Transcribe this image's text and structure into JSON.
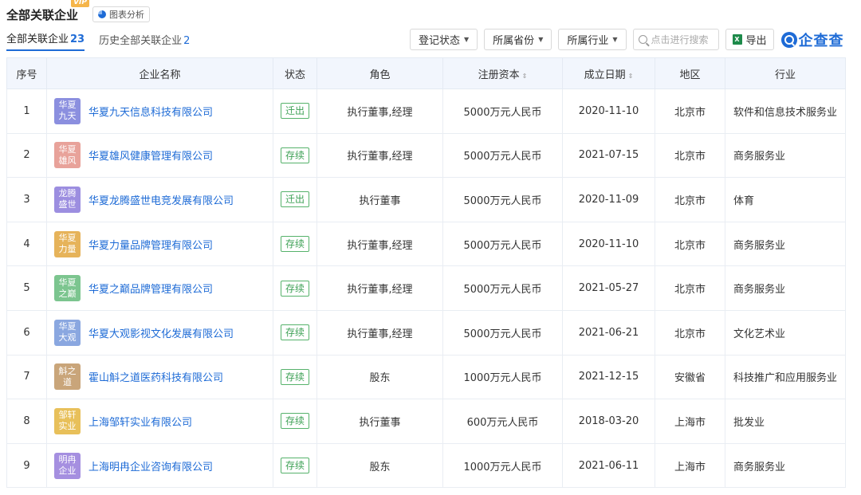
{
  "header": {
    "title": "全部关联企业",
    "vip": "VIP",
    "chart_button": "图表分析"
  },
  "tabs": [
    {
      "label": "全部关联企业",
      "count": "23"
    },
    {
      "label": "历史全部关联企业",
      "count": "2"
    }
  ],
  "toolbar": {
    "filters": [
      "登记状态",
      "所属省份",
      "所属行业"
    ],
    "search_placeholder": "点击进行搜索",
    "export_label": "导出",
    "brand": "企查查"
  },
  "table": {
    "columns": [
      "序号",
      "企业名称",
      "状态",
      "角色",
      "注册资本",
      "成立日期",
      "地区",
      "行业"
    ],
    "rows": [
      {
        "no": "1",
        "logo": "华夏九天",
        "logo_color": "#8b8fdf",
        "name": "华夏九天信息科技有限公司",
        "status": "迁出",
        "role": "执行董事,经理",
        "capital": "5000万元人民币",
        "date": "2020-11-10",
        "region": "北京市",
        "industry": "软件和信息技术服务业"
      },
      {
        "no": "2",
        "logo": "华夏雄风",
        "logo_color": "#e8a29a",
        "name": "华夏雄风健康管理有限公司",
        "status": "存续",
        "role": "执行董事,经理",
        "capital": "5000万元人民币",
        "date": "2021-07-15",
        "region": "北京市",
        "industry": "商务服务业"
      },
      {
        "no": "3",
        "logo": "龙腾盛世",
        "logo_color": "#9c8ee0",
        "name": "华夏龙腾盛世电竞发展有限公司",
        "status": "迁出",
        "role": "执行董事",
        "capital": "5000万元人民币",
        "date": "2020-11-09",
        "region": "北京市",
        "industry": "体育"
      },
      {
        "no": "4",
        "logo": "华夏力量",
        "logo_color": "#e6b35a",
        "name": "华夏力量品牌管理有限公司",
        "status": "存续",
        "role": "执行董事,经理",
        "capital": "5000万元人民币",
        "date": "2020-11-10",
        "region": "北京市",
        "industry": "商务服务业"
      },
      {
        "no": "5",
        "logo": "华夏之巅",
        "logo_color": "#7cc58f",
        "name": "华夏之巅品牌管理有限公司",
        "status": "存续",
        "role": "执行董事,经理",
        "capital": "5000万元人民币",
        "date": "2021-05-27",
        "region": "北京市",
        "industry": "商务服务业"
      },
      {
        "no": "6",
        "logo": "华夏大观",
        "logo_color": "#8aa7e0",
        "name": "华夏大观影视文化发展有限公司",
        "status": "存续",
        "role": "执行董事,经理",
        "capital": "5000万元人民币",
        "date": "2021-06-21",
        "region": "北京市",
        "industry": "文化艺术业"
      },
      {
        "no": "7",
        "logo": "斛之道",
        "logo_color": "#c9a57a",
        "name": "霍山斛之道医药科技有限公司",
        "status": "存续",
        "role": "股东",
        "capital": "1000万元人民币",
        "date": "2021-12-15",
        "region": "安徽省",
        "industry": "科技推广和应用服务业"
      },
      {
        "no": "8",
        "logo": "邹轩实业",
        "logo_color": "#e8c05a",
        "name": "上海邹轩实业有限公司",
        "status": "存续",
        "role": "执行董事",
        "capital": "600万元人民币",
        "date": "2018-03-20",
        "region": "上海市",
        "industry": "批发业"
      },
      {
        "no": "9",
        "logo": "明冉企业",
        "logo_color": "#a58fe0",
        "name": "上海明冉企业咨询有限公司",
        "status": "存续",
        "role": "股东",
        "capital": "1000万元人民币",
        "date": "2021-06-11",
        "region": "上海市",
        "industry": "商务服务业"
      }
    ]
  }
}
